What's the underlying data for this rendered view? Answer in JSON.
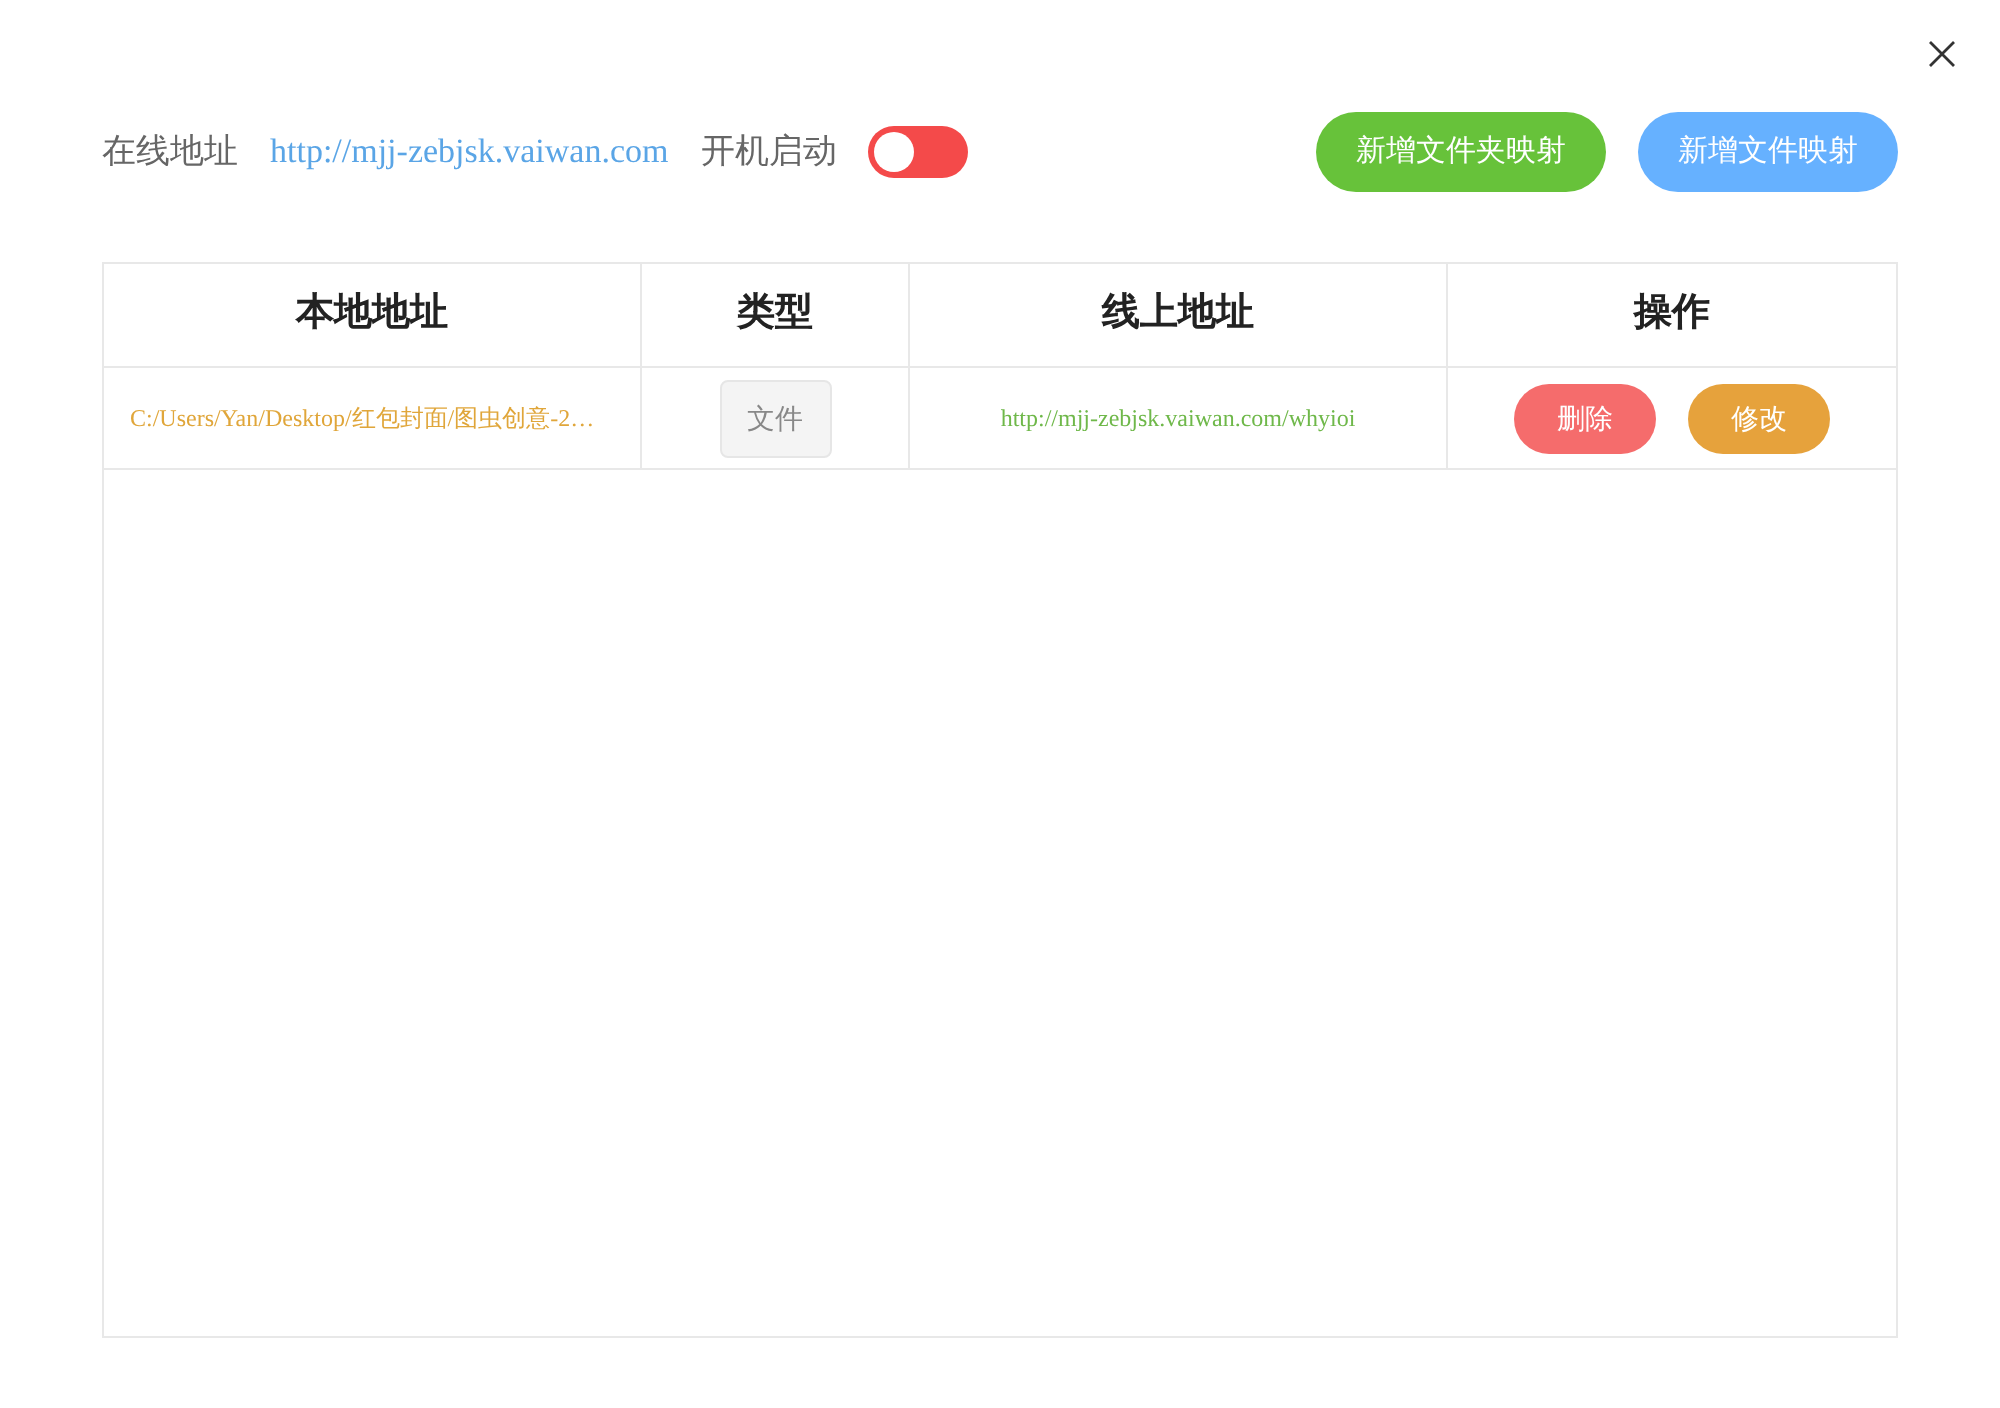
{
  "header": {
    "online_label": "在线地址",
    "online_url": "http://mjj-zebjsk.vaiwan.com",
    "autostart_label": "开机启动",
    "autostart": {
      "on": false
    },
    "buttons": [
      {
        "label": "新增文件夹映射",
        "kind": "folder"
      },
      {
        "label": "新增文件映射",
        "kind": "file"
      }
    ]
  },
  "table": {
    "columns": [
      "本地地址",
      "类型",
      "线上地址",
      "操作"
    ],
    "rows": [
      {
        "local": "C:/Users/Yan/Desktop/红包封面/图虫创意-2…",
        "type": "文件",
        "remote": "http://mjj-zebjsk.vaiwan.com/whyioi",
        "actions": [
          {
            "label": "删除",
            "kind": "delete"
          },
          {
            "label": "修改",
            "kind": "edit"
          }
        ]
      }
    ]
  }
}
